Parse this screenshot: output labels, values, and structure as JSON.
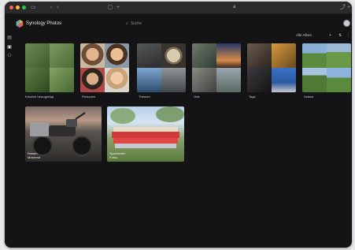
{
  "app": {
    "title": "Synology Photos",
    "search_placeholder": "Suche",
    "url_text": "a"
  },
  "toolbar": {
    "view_label": "Alle Alben"
  },
  "albums": [
    {
      "label": "Kürzlich hinzugefügt"
    },
    {
      "label": "Personen"
    },
    {
      "label": "Themen"
    },
    {
      "label": "Orte"
    },
    {
      "label": "Tags"
    },
    {
      "label": "Videos"
    }
  ],
  "collections": [
    {
      "title": "Reisen",
      "subtitle": "Motorrad"
    },
    {
      "title": "Sportverein",
      "subtitle": "Fotos"
    }
  ],
  "colors": {
    "window_bg": "#141416",
    "titlebar": "#2a2a2d",
    "accent_red": "#ff5f57",
    "accent_yellow": "#febc2e",
    "accent_green": "#28c840"
  }
}
